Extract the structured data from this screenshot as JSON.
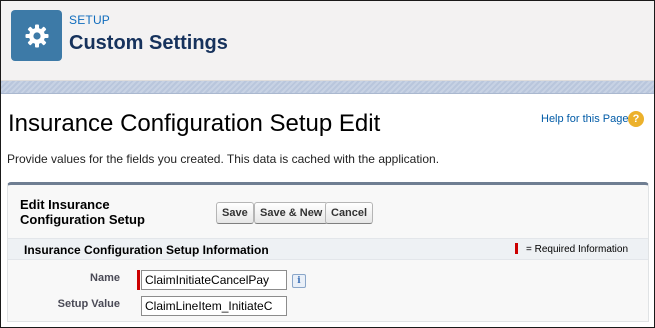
{
  "header": {
    "icon": "gear-icon",
    "eyebrow": "SETUP",
    "title": "Custom Settings"
  },
  "page": {
    "title": "Insurance Configuration Setup Edit",
    "help_link": "Help for this Page",
    "help_icon_glyph": "?",
    "instructions": "Provide values for the fields you created. This data is cached with the application."
  },
  "panel": {
    "title": "Edit Insurance Configuration Setup",
    "buttons": {
      "save": "Save",
      "save_new": "Save & New",
      "cancel": "Cancel"
    },
    "section_title": "Insurance Configuration Setup Information",
    "required_legend": "= Required Information",
    "fields": {
      "name": {
        "label": "Name",
        "value": "ClaimInitiateCancelPay",
        "required": true,
        "info_icon": "i"
      },
      "setup_value": {
        "label": "Setup Value",
        "value": "ClaimLineItem_InitiateC"
      }
    }
  },
  "colors": {
    "brand_icon": "#3d7aa7",
    "title_text": "#16325c",
    "link": "#015ba7",
    "required": "#cc0000"
  }
}
